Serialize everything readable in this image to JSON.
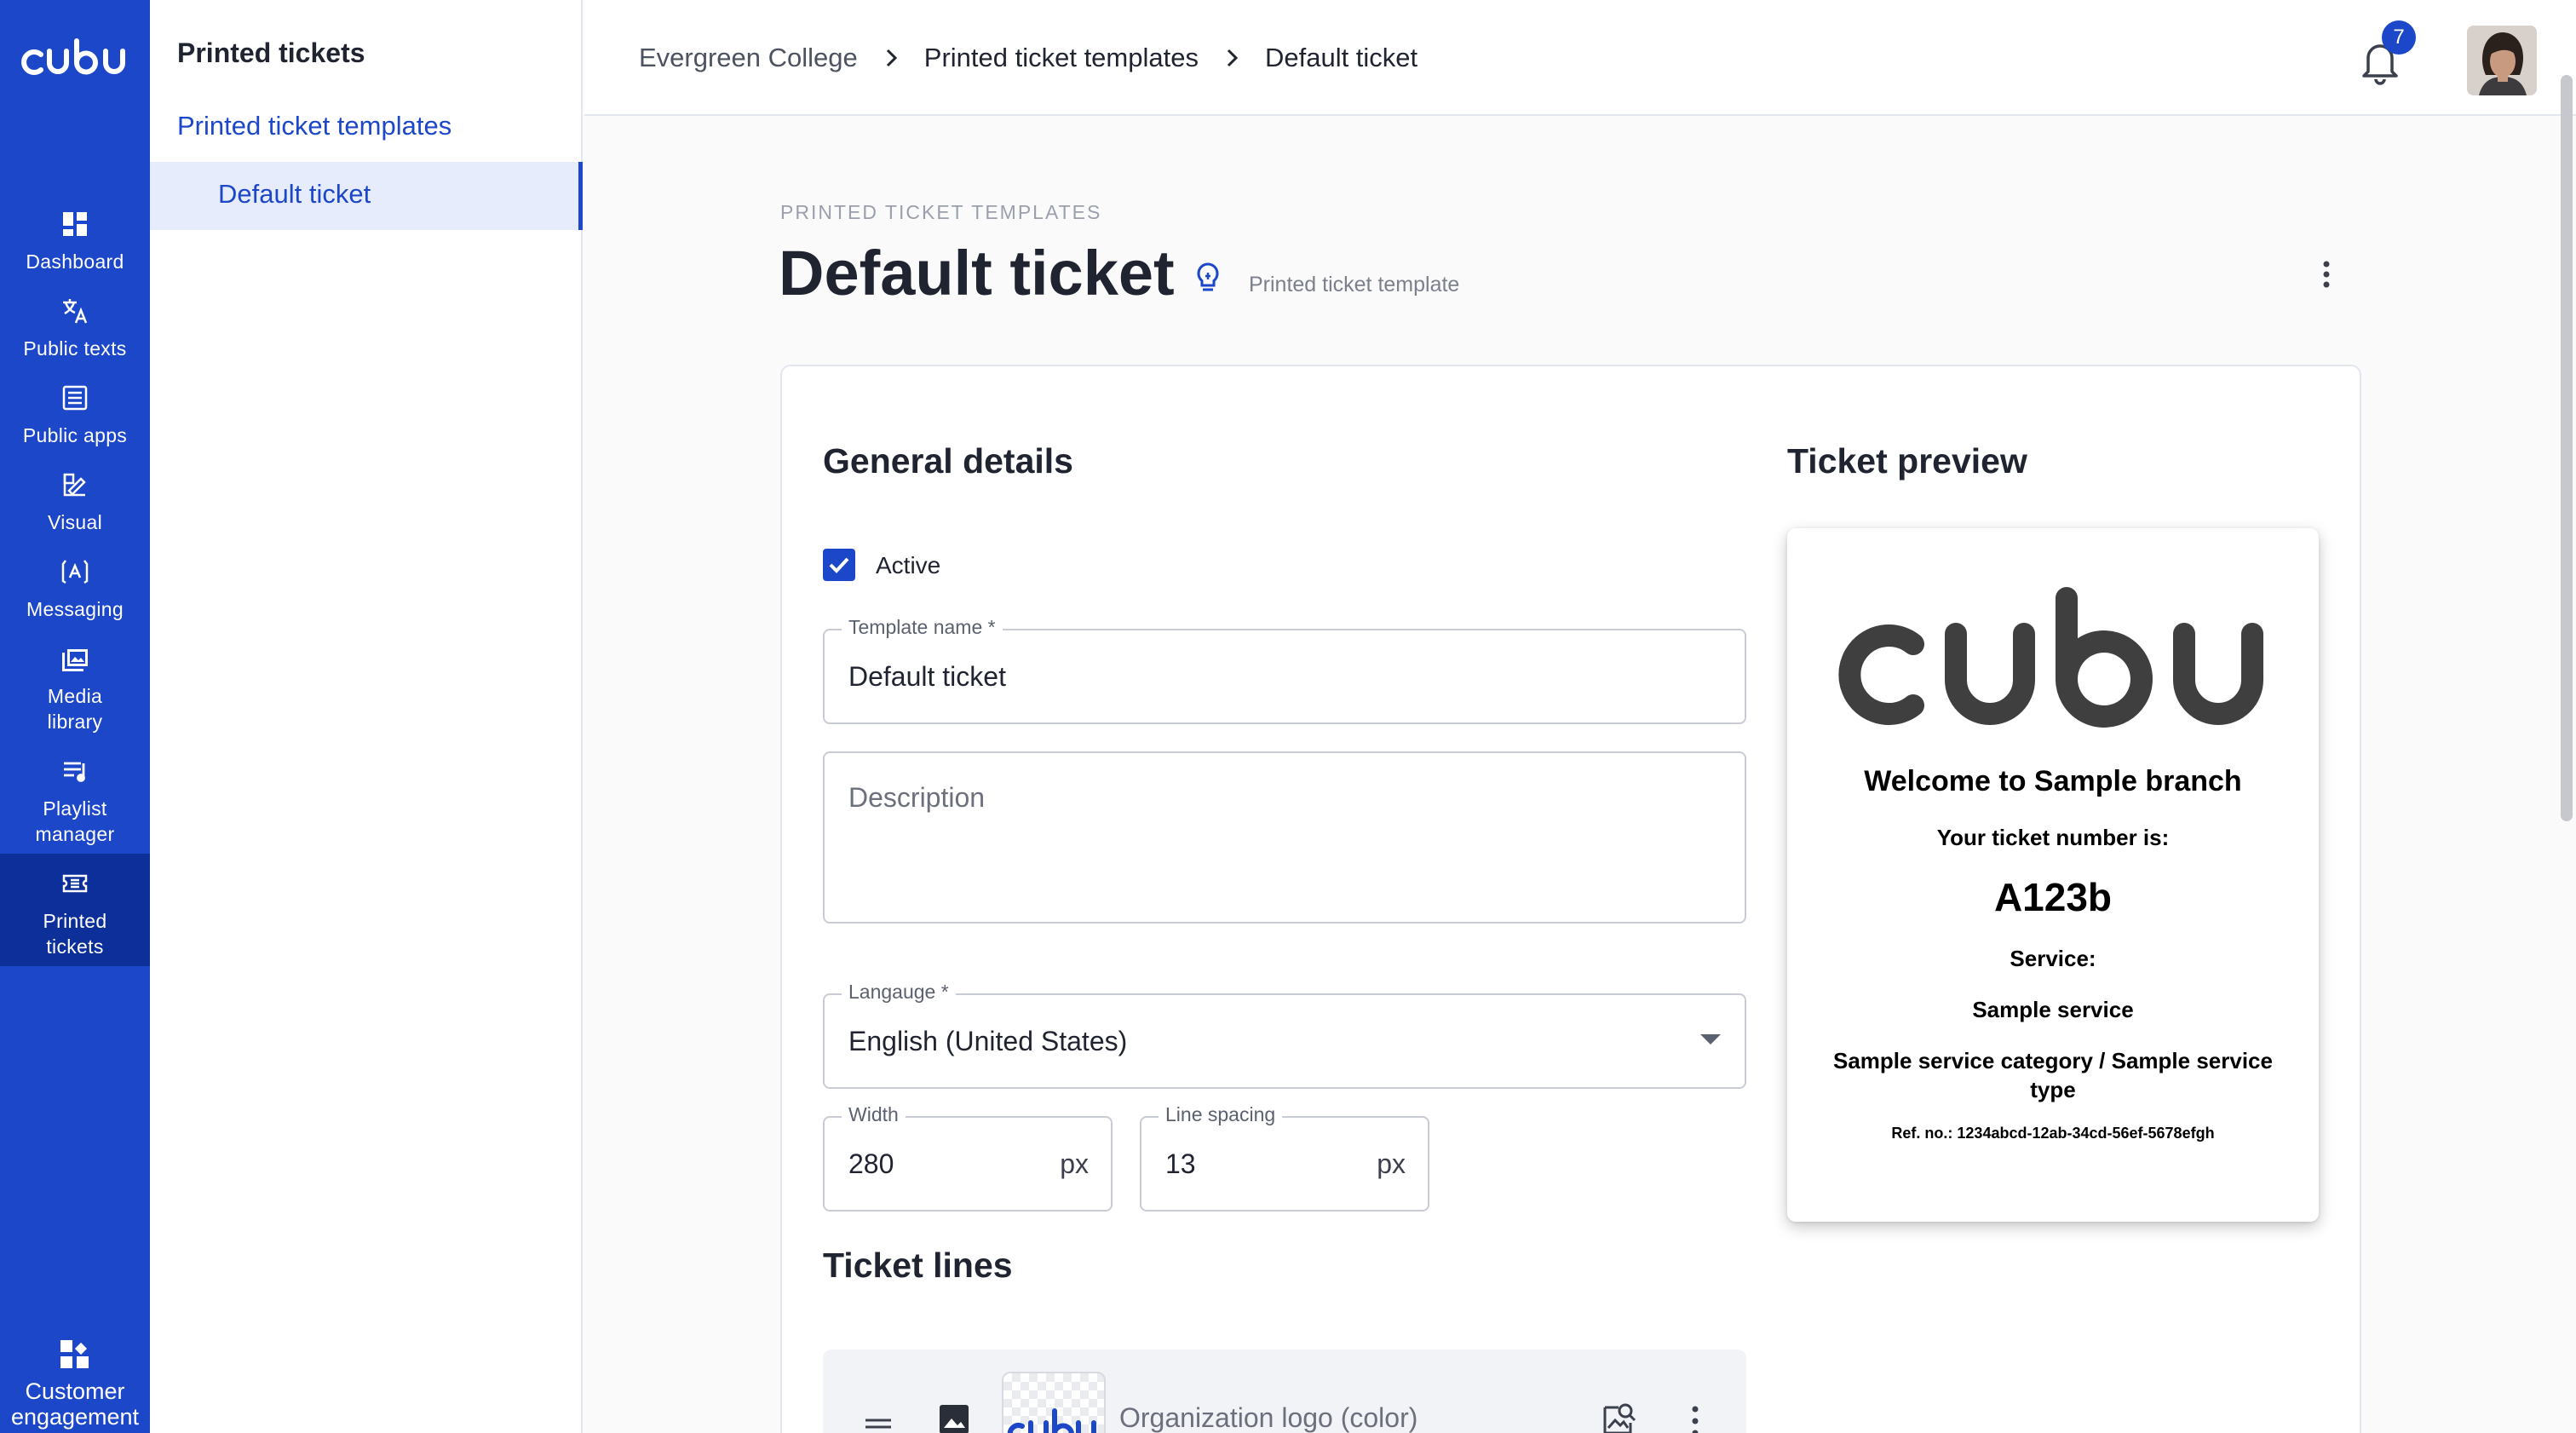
{
  "rail": {
    "logo_text": "cubu",
    "items": [
      {
        "label": "Dashboard",
        "icon": "dashboard-icon"
      },
      {
        "label": "Public texts",
        "icon": "translate-icon"
      },
      {
        "label": "Public apps",
        "icon": "list-icon"
      },
      {
        "label": "Visual",
        "icon": "palette-icon"
      },
      {
        "label": "Messaging",
        "icon": "message-icon"
      },
      {
        "label": "Media\nlibrary",
        "icon": "image-icon"
      },
      {
        "label": "Playlist\nmanager",
        "icon": "playlist-icon"
      },
      {
        "label": "Printed\ntickets",
        "icon": "ticket-icon"
      }
    ],
    "bottom": {
      "label": "Customer\nengagement",
      "icon": "apps-icon"
    }
  },
  "subnav": {
    "heading": "Printed tickets",
    "link": "Printed ticket templates",
    "selected": "Default ticket"
  },
  "header": {
    "breadcrumbs": [
      "Evergreen College",
      "Printed ticket templates",
      "Default ticket"
    ],
    "notification_count": "7"
  },
  "page": {
    "eyebrow": "PRINTED TICKET TEMPLATES",
    "title": "Default ticket",
    "subtitle": "Printed ticket template"
  },
  "form": {
    "section_title": "General details",
    "active_label": "Active",
    "active_checked": true,
    "template_name_label": "Template name *",
    "template_name_value": "Default ticket",
    "description_placeholder": "Description",
    "language_label": "Langauge *",
    "language_value": "English (United States)",
    "width_label": "Width",
    "width_value": "280",
    "width_unit": "px",
    "line_spacing_label": "Line spacing",
    "line_spacing_value": "13",
    "line_spacing_unit": "px",
    "ticket_lines_title": "Ticket lines",
    "line_items": [
      {
        "label": "Organization logo (color)",
        "thumb_text": "cubu"
      }
    ]
  },
  "preview": {
    "title": "Ticket preview",
    "logo_text": "cubu",
    "welcome": "Welcome to Sample branch",
    "number_label": "Your ticket number is:",
    "number": "A123b",
    "service_label": "Service:",
    "service": "Sample service",
    "category_line1": "Sample service category / Sample service",
    "category_line2": "type",
    "ref": "Ref. no.: 1234abcd-12ab-34cd-56ef-5678efgh"
  },
  "colors": {
    "brand": "#1c47c9",
    "rail_active": "#0c2f9a",
    "selected_bg": "#e6ecfb"
  }
}
